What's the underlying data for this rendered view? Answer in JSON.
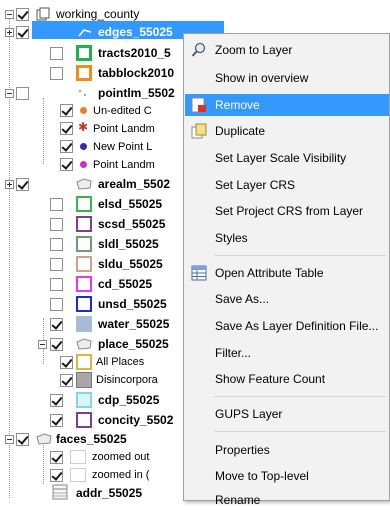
{
  "layers": [
    {
      "label": "working_county",
      "bold": false,
      "checked": true
    },
    {
      "label": "edges_55025",
      "bold": true,
      "checked": true,
      "selected": true
    },
    {
      "label": "tracts2010_5",
      "bold": true,
      "checked": false,
      "color": "#23b14d"
    },
    {
      "label": "tabblock2010",
      "bold": true,
      "checked": false,
      "color": "#f28c1a"
    },
    {
      "label": "pointlm_5502",
      "bold": true,
      "checked": false
    },
    {
      "label": "Un-edited C",
      "bold": false,
      "checked": true,
      "color": "#e8822a"
    },
    {
      "label": "Point Landm",
      "bold": false,
      "checked": true,
      "color": "#c0392b"
    },
    {
      "label": "New Point L",
      "bold": false,
      "checked": true,
      "color": "#3a2aa8"
    },
    {
      "label": "Point Landm",
      "bold": false,
      "checked": true,
      "color": "#d22fb8"
    },
    {
      "label": "arealm_5502",
      "bold": true,
      "checked": true
    },
    {
      "label": "elsd_55025",
      "bold": true,
      "checked": false,
      "color": "#3bb34a"
    },
    {
      "label": "scsd_55025",
      "bold": true,
      "checked": false,
      "color": "#7a3f99"
    },
    {
      "label": "sldl_55025",
      "bold": true,
      "checked": false,
      "color": "#6f9a7a"
    },
    {
      "label": "sldu_55025",
      "bold": true,
      "checked": false,
      "color": "#c9a58a"
    },
    {
      "label": "cd_55025",
      "bold": true,
      "checked": false,
      "color": "#e43be0"
    },
    {
      "label": "unsd_55025",
      "bold": true,
      "checked": false,
      "color": "#1b2ad8"
    },
    {
      "label": "water_55025",
      "bold": true,
      "checked": true,
      "color": "#a8bcd8"
    },
    {
      "label": "place_55025",
      "bold": true,
      "checked": true
    },
    {
      "label": "All Places",
      "bold": false,
      "checked": true,
      "color": "#e2b43a"
    },
    {
      "label": "Disincorpora",
      "bold": false,
      "checked": true,
      "color": "#a7a7a7"
    },
    {
      "label": "cdp_55025",
      "bold": true,
      "checked": true,
      "color": "#7fd8e3"
    },
    {
      "label": "concity_5502",
      "bold": true,
      "checked": true,
      "color": "#7a3f99"
    },
    {
      "label": "faces_55025",
      "bold": true,
      "checked": true
    },
    {
      "label": "zoomed out",
      "bold": false,
      "checked": true
    },
    {
      "label": "zoomed in (",
      "bold": false,
      "checked": true
    },
    {
      "label": "addr_55025",
      "bold": true,
      "checked": false
    }
  ],
  "menu": {
    "items": [
      {
        "label": "Zoom to Layer",
        "icon": "zoom-icon"
      },
      {
        "label": "Show in overview"
      },
      {
        "label": "Remove",
        "icon": "remove-icon",
        "highlighted": true
      },
      {
        "label": "Duplicate",
        "icon": "duplicate-icon"
      },
      {
        "label": "Set Layer Scale Visibility"
      },
      {
        "label": "Set Layer CRS"
      },
      {
        "label": "Set Project CRS from Layer"
      },
      {
        "label": "Styles"
      },
      {
        "label": "Open Attribute Table",
        "icon": "table-icon"
      },
      {
        "label": "Save As..."
      },
      {
        "label": "Save As Layer Definition File..."
      },
      {
        "label": "Filter..."
      },
      {
        "label": "Show Feature Count"
      },
      {
        "label": "GUPS Layer"
      },
      {
        "label": "Properties"
      },
      {
        "label": "Move to Top-level"
      },
      {
        "label": "Rename"
      }
    ]
  }
}
